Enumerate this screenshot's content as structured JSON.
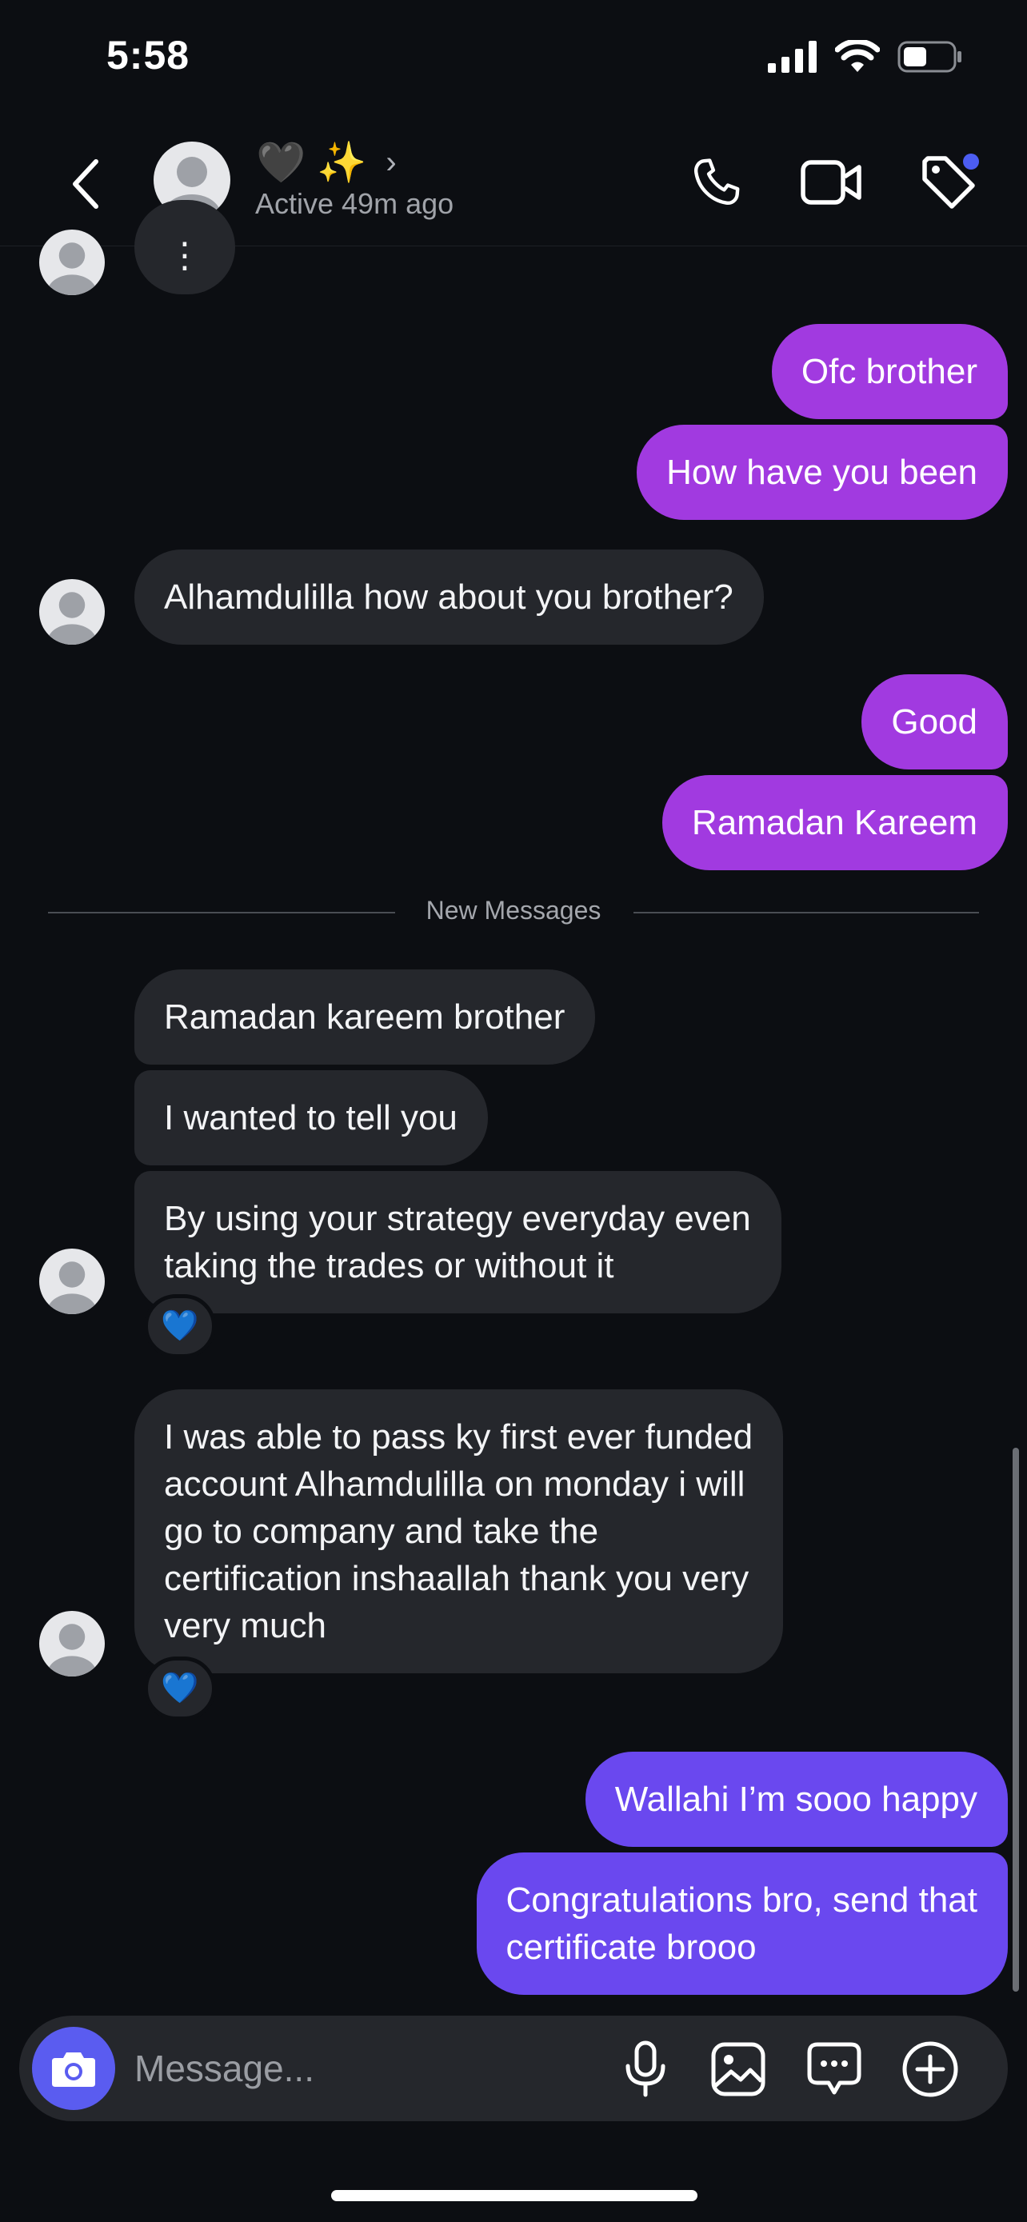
{
  "status_bar": {
    "time": "5:58"
  },
  "header": {
    "contact_name": "🖤 ✨",
    "active_status": "Active 49m ago",
    "notification_color": "#4c5df2"
  },
  "colors": {
    "background": "#0c0e12",
    "received_bubble": "#25272c",
    "sent_purple": "#a13ae0",
    "sent_violet": "#6a48ef",
    "camera_button": "#5a5cf0"
  },
  "messages": [
    {
      "direction": "received",
      "text": "⋮"
    },
    {
      "direction": "sent",
      "text": "Ofc brother"
    },
    {
      "direction": "sent",
      "text": "How have you been"
    },
    {
      "direction": "received",
      "text": "Alhamdulilla how about you brother?"
    },
    {
      "direction": "sent",
      "text": "Good"
    },
    {
      "direction": "sent",
      "text": "Ramadan Kareem"
    },
    {
      "direction": "received",
      "text": "Ramadan kareem brother"
    },
    {
      "direction": "received",
      "text": "I wanted to tell you"
    },
    {
      "direction": "received",
      "text": "By using your strategy everyday even\ntaking the trades or without it",
      "reaction": "💙"
    },
    {
      "direction": "received",
      "text": "I was able to pass ky first ever funded\naccount Alhamdulilla on monday i will\ngo to company and take the\ncertification inshaallah thank you very\nvery much",
      "reaction": "💙"
    },
    {
      "direction": "sent",
      "text": "Wallahi I’m sooo happy"
    },
    {
      "direction": "sent",
      "text": "Congratulations bro, send that\ncertificate brooo"
    }
  ],
  "divider": {
    "label": "New Messages"
  },
  "composer": {
    "placeholder": "Message...",
    "icons": [
      "camera-icon",
      "microphone-icon",
      "gallery-icon",
      "sticker-icon",
      "plus-icon"
    ]
  }
}
